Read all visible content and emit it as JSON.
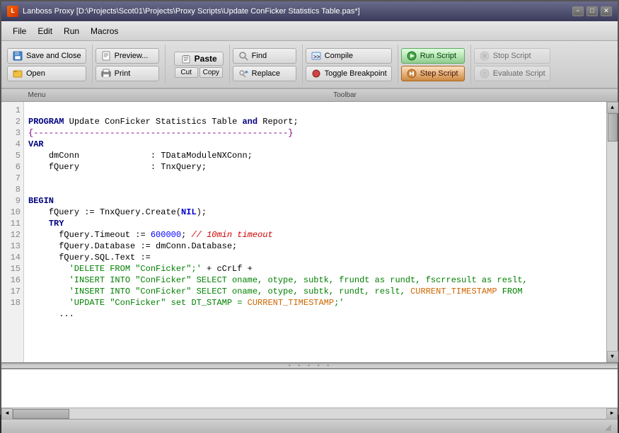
{
  "titleBar": {
    "title": "Lanboss Proxy [D:\\Projects\\Scot01\\Projects\\Proxy Scripts\\Update ConFicker Statistics Table.pas*]",
    "minimizeBtn": "−",
    "restoreBtn": "□",
    "closeBtn": "✕"
  },
  "menuBar": {
    "items": [
      {
        "id": "file",
        "label": "File"
      },
      {
        "id": "edit",
        "label": "Edit"
      },
      {
        "id": "run",
        "label": "Run"
      },
      {
        "id": "macros",
        "label": "Macros"
      }
    ],
    "menuSectionLabel": "Menu",
    "toolbarSectionLabel": "Toolbar"
  },
  "toolbar": {
    "saveAndClose": "Save and Close",
    "preview": "Preview...",
    "open": "Open",
    "print": "Print",
    "cut": "Cut",
    "copy": "Copy",
    "paste": "Paste",
    "find": "Find",
    "replace": "Replace",
    "compile": "Compile",
    "toggleBreakpoint": "Toggle Breakpoint",
    "runScript": "Run Script",
    "stopScript": "Stop Script",
    "stepScript": "Step Script",
    "evaluateScript": "Evaluate Script"
  },
  "code": {
    "lines": [
      {
        "num": 1,
        "content": "PROGRAM Update ConFicker Statistics Table and Report;"
      },
      {
        "num": 2,
        "content": "{--------------------------------------------------}"
      },
      {
        "num": 3,
        "content": "VAR"
      },
      {
        "num": 4,
        "content": "    dmConn              : TDataModuleNXConn;"
      },
      {
        "num": 5,
        "content": "    fQuery              : TnxQuery;"
      },
      {
        "num": 6,
        "content": ""
      },
      {
        "num": 7,
        "content": ""
      },
      {
        "num": 8,
        "content": "BEGIN"
      },
      {
        "num": 9,
        "content": "    fQuery := TnxQuery.Create(NIL);"
      },
      {
        "num": 10,
        "content": "    TRY"
      },
      {
        "num": 11,
        "content": "      fQuery.Timeout := 600000; // 10min timeout"
      },
      {
        "num": 12,
        "content": "      fQuery.Database := dmConn.Database;"
      },
      {
        "num": 13,
        "content": "      fQuery.SQL.Text :="
      },
      {
        "num": 14,
        "content": "        'DELETE FROM \"ConFicker\";' + cCrLf +"
      },
      {
        "num": 15,
        "content": "        'INSERT INTO \"ConFicker\" SELECT oname, otype, subtk, frundt as rundt, fscrresult as reslt,"
      },
      {
        "num": 16,
        "content": "        'INSERT INTO \"ConFicker\" SELECT oname, otype, subtk, rundt, reslt, CURRENT_TIMESTAMP FROM"
      },
      {
        "num": 17,
        "content": "        'UPDATE \"ConFicker\" set DT_STAMP = CURRENT_TIMESTAMP;'"
      },
      {
        "num": 18,
        "content": "      ..."
      }
    ]
  }
}
